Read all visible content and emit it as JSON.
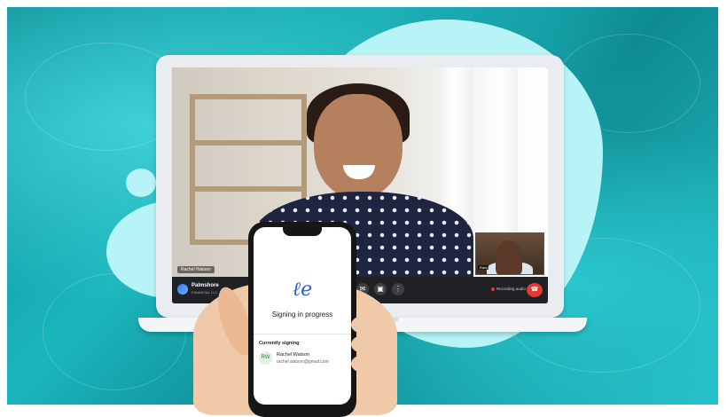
{
  "meeting": {
    "main_participant_name": "Rachel Watson",
    "pip_participant_name": "Ravi",
    "recording_label": "Recording audio",
    "brand_name": "Palmshore",
    "brand_sub": "FINANCIAL LLC"
  },
  "phone": {
    "status_title": "Signing in progress",
    "section_label": "Currently signing",
    "signer_initials": "RW",
    "signer_name": "Rachel Watson",
    "signer_email": "rachel.watson@gmail.com"
  },
  "colors": {
    "background_teal": "#1bb6bd",
    "blob": "#b8f4f7",
    "end_call": "#e53935",
    "signature_blue": "#2d5bd1"
  },
  "icons": [
    "signature-icon",
    "message-icon",
    "screen-share-icon",
    "more-options-icon",
    "end-call-icon",
    "record-dot-icon"
  ]
}
